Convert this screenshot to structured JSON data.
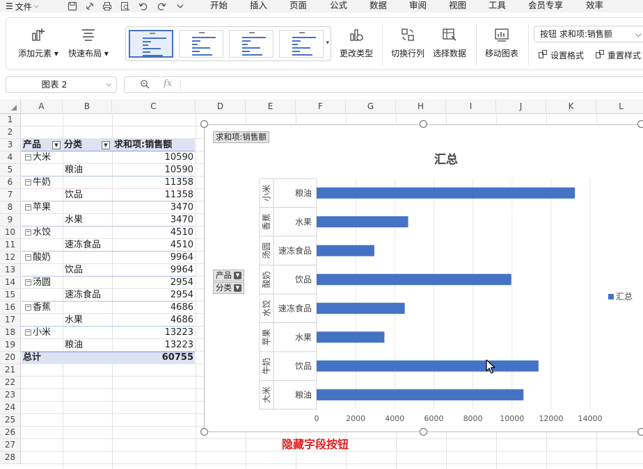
{
  "menu": {
    "file_label": "文件",
    "tabs": [
      "开始",
      "插入",
      "页面",
      "公式",
      "数据",
      "审阅",
      "视图",
      "工具",
      "会员专享",
      "效率"
    ]
  },
  "ribbon": {
    "add_element": "添加元素",
    "quick_layout": "快速布局",
    "change_type": "更改类型",
    "switch_row_col": "切换行列",
    "select_data": "选择数据",
    "move_chart": "移动图表",
    "combo_value": "按钮 求和项:销售额",
    "set_format": "设置格式",
    "reset_style": "重置样式"
  },
  "formula_bar": {
    "name_box": "图表 2",
    "fx": "fx",
    "content": ""
  },
  "columns": [
    "A",
    "B",
    "C",
    "D",
    "E",
    "F",
    "G",
    "H",
    "I",
    "J",
    "K",
    "L"
  ],
  "rows": [
    "1",
    "2",
    "3",
    "4",
    "5",
    "6",
    "7",
    "8",
    "9",
    "10",
    "11",
    "12",
    "13",
    "14",
    "15",
    "16",
    "17",
    "18",
    "19",
    "20",
    "21",
    "22",
    "23",
    "24",
    "25",
    "26",
    "27",
    "28"
  ],
  "pivot": {
    "headers": {
      "product": "产品",
      "category": "分类",
      "sum": "求和项:销售额"
    },
    "groups": [
      {
        "product": "大米",
        "subtotal": "10590",
        "category": "粮油",
        "value": "10590"
      },
      {
        "product": "牛奶",
        "subtotal": "11358",
        "category": "饮品",
        "value": "11358"
      },
      {
        "product": "苹果",
        "subtotal": "3470",
        "category": "水果",
        "value": "3470"
      },
      {
        "product": "水饺",
        "subtotal": "4510",
        "category": "速冻食品",
        "value": "4510"
      },
      {
        "product": "酸奶",
        "subtotal": "9964",
        "category": "饮品",
        "value": "9964"
      },
      {
        "product": "汤圆",
        "subtotal": "2954",
        "category": "速冻食品",
        "value": "2954"
      },
      {
        "product": "香蕉",
        "subtotal": "4686",
        "category": "水果",
        "value": "4686"
      },
      {
        "product": "小米",
        "subtotal": "13223",
        "category": "粮油",
        "value": "13223"
      }
    ],
    "total_label": "总计",
    "total_value": "60755"
  },
  "chart_buttons": {
    "value_field": "求和项:销售额",
    "axis_field_1": "产品",
    "axis_field_2": "分类"
  },
  "chart_data": {
    "type": "bar",
    "orientation": "horizontal",
    "title": "汇总",
    "categories": [
      {
        "outer": "小米",
        "inner": "粮油"
      },
      {
        "outer": "香蕉",
        "inner": "水果"
      },
      {
        "outer": "汤圆",
        "inner": "速冻食品"
      },
      {
        "outer": "酸奶",
        "inner": "饮品"
      },
      {
        "outer": "水饺",
        "inner": "速冻食品"
      },
      {
        "outer": "苹果",
        "inner": "水果"
      },
      {
        "outer": "牛奶",
        "inner": "饮品"
      },
      {
        "outer": "大米",
        "inner": "粮油"
      }
    ],
    "series": [
      {
        "name": "汇总",
        "values": [
          13223,
          4686,
          2954,
          9964,
          4510,
          3470,
          11358,
          10590
        ]
      }
    ],
    "xlim": [
      0,
      14000
    ],
    "xticks": [
      0,
      2000,
      4000,
      6000,
      8000,
      10000,
      12000,
      14000
    ],
    "grid": true,
    "legend": "right",
    "color": "#4472c4"
  },
  "caption": "隐藏字段按钮"
}
